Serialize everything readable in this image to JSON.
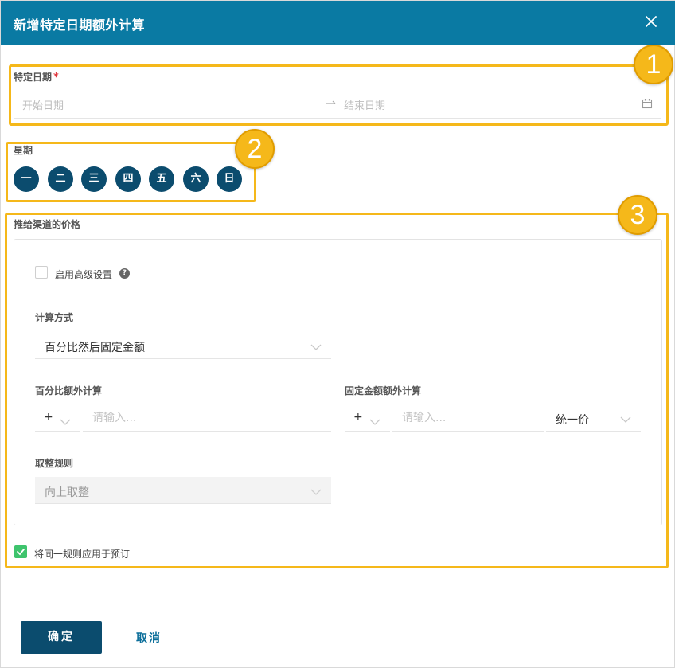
{
  "dialog": {
    "title": "新增特定日期额外计算",
    "close_icon": "close-icon"
  },
  "date_range": {
    "label": "特定日期",
    "required_mark": "*",
    "start_placeholder": "开始日期",
    "end_placeholder": "结束日期"
  },
  "weekdays": {
    "label": "星期",
    "days": [
      "一",
      "二",
      "三",
      "四",
      "五",
      "六",
      "日"
    ]
  },
  "channel_price": {
    "label": "推给渠道的价格",
    "advanced": {
      "label": "启用高级设置",
      "help": "?",
      "checked": false
    },
    "calc_method": {
      "label": "计算方式",
      "value": "百分比然后固定金额"
    },
    "percent_extra": {
      "label": "百分比额外计算",
      "operator": "+",
      "placeholder": "请输入..."
    },
    "fixed_extra": {
      "label": "固定金额额外计算",
      "operator": "+",
      "placeholder": "请输入...",
      "mode": "统一价"
    },
    "rounding": {
      "label": "取整规则",
      "value": "向上取整"
    }
  },
  "apply_to_booking": {
    "label": "将同一规则应用于预订",
    "checked": true
  },
  "footer": {
    "ok_label": "确定",
    "cancel_label": "取消"
  },
  "annotations": [
    "1",
    "2",
    "3"
  ],
  "colors": {
    "header": "#0a7aa3",
    "primary": "#0b4c6e",
    "accent_green": "#3ec46d",
    "annotation": "#f5b81a"
  }
}
